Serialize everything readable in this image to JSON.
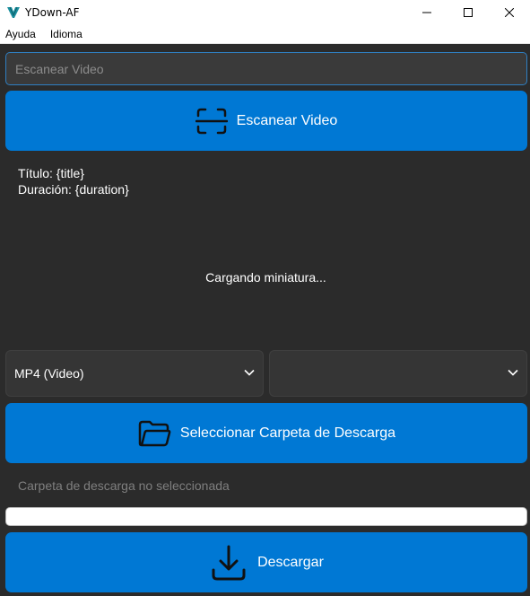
{
  "window": {
    "title": "YDown-AF",
    "controls": {
      "minimize_icon": "minimize-icon",
      "maximize_icon": "maximize-icon",
      "close_icon": "close-icon"
    }
  },
  "menu": {
    "items": [
      {
        "label": "Ayuda"
      },
      {
        "label": "Idioma"
      }
    ]
  },
  "search": {
    "placeholder": "Escanear Video",
    "value": ""
  },
  "scan_button": {
    "label": "Escanear Video",
    "icon": "scan-icon"
  },
  "video_info": {
    "title_line": "Título: {title}",
    "duration_line": "Duración: {duration}"
  },
  "thumbnail": {
    "status": "Cargando miniatura..."
  },
  "format_select": {
    "selected": "MP4 (Video)"
  },
  "quality_select": {
    "selected": ""
  },
  "folder_button": {
    "label": "Seleccionar Carpeta de Descarga",
    "icon": "folder-icon"
  },
  "folder_status": "Carpeta de descarga no seleccionada",
  "progress": {
    "value": 0
  },
  "download_button": {
    "label": "Descargar",
    "icon": "download-icon"
  },
  "colors": {
    "accent": "#0078d4",
    "background": "#2b2b2b",
    "input_bg": "#3a3a3a",
    "select_bg": "#353535",
    "input_border": "#2f7fc1",
    "muted_text": "#7f7f7f",
    "logo": "#1a8f9e"
  }
}
